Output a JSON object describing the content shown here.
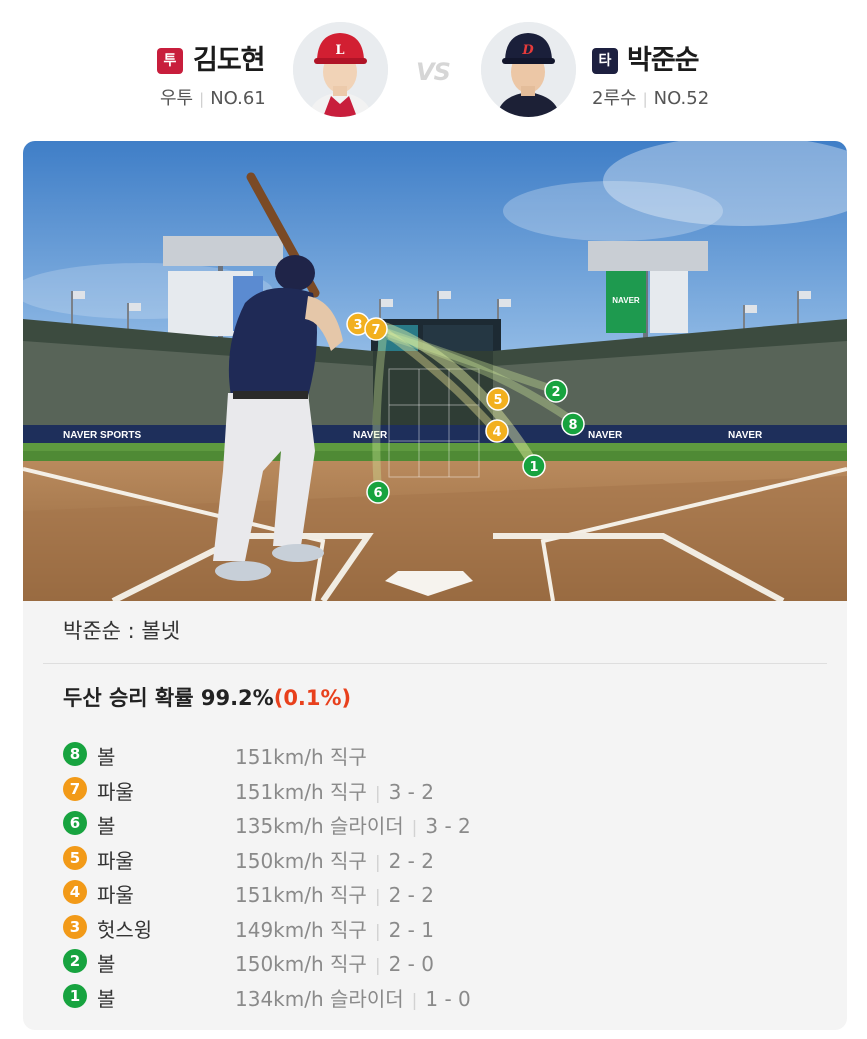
{
  "pitcher": {
    "badge": "투",
    "name": "김도현",
    "position": "우투",
    "number": "NO.61",
    "badge_color": "#c81e3c"
  },
  "vs_label": "VS",
  "batter": {
    "badge": "타",
    "name": "박준순",
    "position": "2루수",
    "number": "NO.52",
    "badge_color": "#1d2040"
  },
  "field": {
    "signboard_text": "NAVER",
    "ad_text": "NAVER SPORTS"
  },
  "result_text": "박준순 : 볼넷",
  "win_probability": {
    "label": "두산 승리 확률",
    "value": "99.2%",
    "change": "(0.1%)"
  },
  "colors": {
    "ball": "#17a33f",
    "strike": "#f29a18",
    "prob_change": "#e8401c"
  },
  "pitches": [
    {
      "num": "8",
      "result": "볼",
      "speed": "151km/h",
      "type": "직구",
      "count": "",
      "kind": "ball"
    },
    {
      "num": "7",
      "result": "파울",
      "speed": "151km/h",
      "type": "직구",
      "count": "3 - 2",
      "kind": "strike"
    },
    {
      "num": "6",
      "result": "볼",
      "speed": "135km/h",
      "type": "슬라이더",
      "count": "3 - 2",
      "kind": "ball"
    },
    {
      "num": "5",
      "result": "파울",
      "speed": "150km/h",
      "type": "직구",
      "count": "2 - 2",
      "kind": "strike"
    },
    {
      "num": "4",
      "result": "파울",
      "speed": "151km/h",
      "type": "직구",
      "count": "2 - 2",
      "kind": "strike"
    },
    {
      "num": "3",
      "result": "헛스윙",
      "speed": "149km/h",
      "type": "직구",
      "count": "2 - 1",
      "kind": "strike"
    },
    {
      "num": "2",
      "result": "볼",
      "speed": "150km/h",
      "type": "직구",
      "count": "2 - 0",
      "kind": "ball"
    },
    {
      "num": "1",
      "result": "볼",
      "speed": "134km/h",
      "type": "슬라이더",
      "count": "1 - 0",
      "kind": "ball"
    }
  ]
}
